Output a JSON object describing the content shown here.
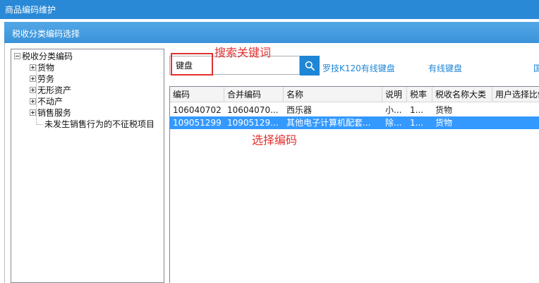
{
  "window": {
    "title": "商品编码维护"
  },
  "dialog": {
    "title": "税收分类编码选择"
  },
  "tree": {
    "root": "税收分类编码",
    "items": [
      {
        "label": "货物"
      },
      {
        "label": "劳务"
      },
      {
        "label": "无形资产"
      },
      {
        "label": "不动产"
      },
      {
        "label": "销售服务"
      },
      {
        "label": "未发生销售行为的不征税项目"
      }
    ]
  },
  "search": {
    "value": "键盘",
    "icon": "search-icon"
  },
  "annotations": {
    "search_keyword": "搜索关键词",
    "select_code": "选择编码"
  },
  "suggestions": [
    "罗技K120有线键盘",
    "有线键盘",
    "国"
  ],
  "table": {
    "columns": [
      "编码",
      "合并编码",
      "名称",
      "说明",
      "税率",
      "税收名称大类",
      "用户选择比例"
    ],
    "rows": [
      {
        "code": "106040702",
        "merged": "10604070...",
        "name": "西乐器",
        "desc": "小...",
        "rate": "1...",
        "category": "货物",
        "ratio": "",
        "selected": false
      },
      {
        "code": "109051299",
        "merged": "10905129...",
        "name": "其他电子计算机配套...",
        "desc": "除...",
        "rate": "1...",
        "category": "货物",
        "ratio": "",
        "selected": true
      }
    ]
  },
  "colors": {
    "title_bar": "#2a89d6",
    "accent": "#1f86d6",
    "selection": "#3399ff",
    "annotation": "#e03131"
  }
}
